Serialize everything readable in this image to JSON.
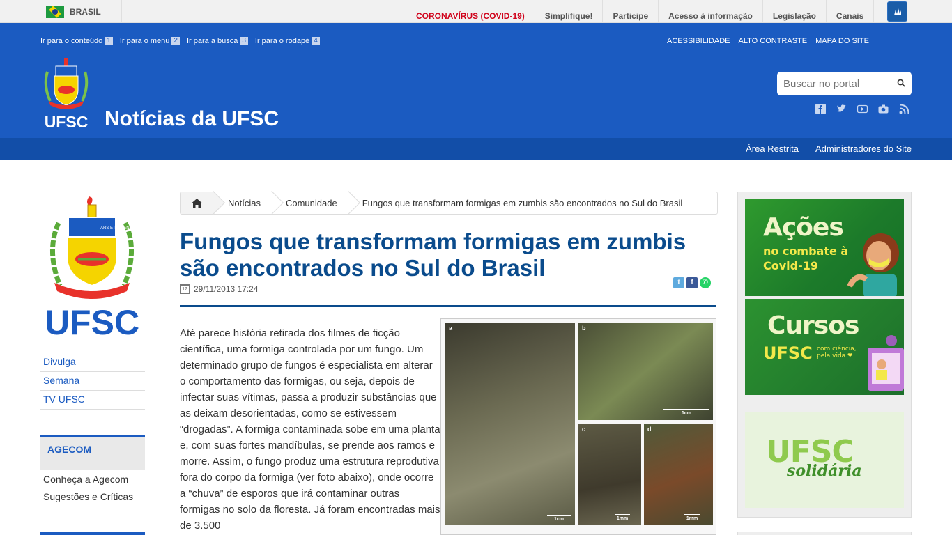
{
  "govbar": {
    "country": "BRASIL",
    "links": [
      "CORONAVÍRUS (COVID-19)",
      "Simplifique!",
      "Participe",
      "Acesso à informação",
      "Legislação",
      "Canais"
    ]
  },
  "header": {
    "skip_links": [
      {
        "label": "Ir para o conteúdo",
        "num": "1"
      },
      {
        "label": "Ir para o menu",
        "num": "2"
      },
      {
        "label": "Ir para a busca",
        "num": "3"
      },
      {
        "label": "Ir para o rodapé",
        "num": "4"
      }
    ],
    "accessibility": [
      "ACESSIBILIDADE",
      "ALTO CONTRASTE",
      "MAPA DO SITE"
    ],
    "logo_text": "UFSC",
    "site_title": "Notícias da UFSC",
    "search_placeholder": "Buscar no portal",
    "social_icons": [
      "facebook-icon",
      "twitter-icon",
      "youtube-icon",
      "camera-icon",
      "rss-icon"
    ],
    "subbar_links": [
      "Área Restrita",
      "Administradores do Site"
    ]
  },
  "sidebar": {
    "logo_text": "UFSC",
    "nav": [
      "Divulga",
      "Semana",
      "TV UFSC"
    ],
    "agecom": {
      "title": "AGECOM",
      "links": [
        "Conheça a Agecom",
        "Sugestões e Críticas"
      ]
    }
  },
  "breadcrumb": [
    "Notícias",
    "Comunidade",
    "Fungos que transformam formigas em zumbis são encontrados no Sul do Brasil"
  ],
  "article": {
    "title": "Fungos que transformam formigas em zumbis são encontrados no Sul do Brasil",
    "date": "29/11/2013 17:24",
    "calendar_day": "17",
    "body": "Até parece história retirada dos filmes de ficção científica, uma formiga controlada por um fungo. Um determinado grupo de fungos é especialista em alterar o comportamento das formigas, ou seja, depois de infectar suas vítimas, passa a produzir substâncias que as deixam desorientadas, como se estivessem “drogadas”. A formiga contaminada sobe em uma planta e, com suas fortes mandíbulas, se prende aos ramos e morre. Assim, o fungo produz uma estrutura reprodutiva fora do corpo da formiga (ver foto abaixo), onde ocorre a “chuva” de esporos que irá contaminar outras formigas no solo da floresta. Já foram encontradas mais de 3.500",
    "figure": {
      "panels": [
        {
          "label": "a",
          "scale": "1cm"
        },
        {
          "label": "b",
          "scale": "1cm"
        },
        {
          "label": "c",
          "scale": "1mm"
        },
        {
          "label": "d",
          "scale": "1mm"
        }
      ]
    }
  },
  "right": {
    "banner1": {
      "title": "Ações",
      "subtitle_line1": "no combate à",
      "subtitle_line2": "Covid-19"
    },
    "banner2": {
      "title": "Cursos",
      "brand": "UFSC",
      "tagline_line1": "com ciência,",
      "tagline_line2": "pela vida ❤"
    },
    "banner3": {
      "title": "UFSC",
      "subtitle": "solidária"
    }
  },
  "colors": {
    "header_blue": "#1b5bc1",
    "title_blue": "#0a4b8c",
    "covid_red": "#d0021b"
  }
}
